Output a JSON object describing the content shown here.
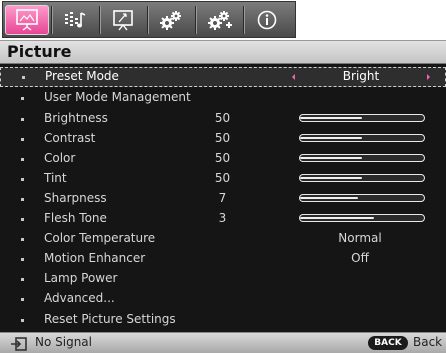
{
  "tabs": [
    {
      "icon": "picture-screen-icon",
      "active": true
    },
    {
      "icon": "audio-eq-icon",
      "active": false
    },
    {
      "icon": "display-screen-icon",
      "active": false
    },
    {
      "icon": "system-gears-icon",
      "active": false
    },
    {
      "icon": "advanced-gears-icon",
      "active": false
    },
    {
      "icon": "info-icon",
      "active": false
    }
  ],
  "page_title": "Picture",
  "menu": {
    "selected_index": 0,
    "items": [
      {
        "label": "Preset Mode",
        "value": "Bright",
        "has_arrows": true
      },
      {
        "label": "User Mode Management"
      },
      {
        "label": "Brightness",
        "number": "50",
        "slider": 0.5
      },
      {
        "label": "Contrast",
        "number": "50",
        "slider": 0.5
      },
      {
        "label": "Color",
        "number": "50",
        "slider": 0.5
      },
      {
        "label": "Tint",
        "number": "50",
        "slider": 0.5
      },
      {
        "label": "Sharpness",
        "number": "7",
        "slider": 0.47
      },
      {
        "label": "Flesh Tone",
        "number": "3",
        "slider": 0.6
      },
      {
        "label": "Color Temperature",
        "value": "Normal"
      },
      {
        "label": "Motion Enhancer",
        "value": "Off"
      },
      {
        "label": "Lamp Power"
      },
      {
        "label": "Advanced..."
      },
      {
        "label": "Reset Picture Settings"
      }
    ]
  },
  "status": {
    "signal_text": "No Signal",
    "back_button": "BACK",
    "back_label": "Back"
  },
  "colors": {
    "accent": "#e64695",
    "panel_bg": "#151515"
  }
}
